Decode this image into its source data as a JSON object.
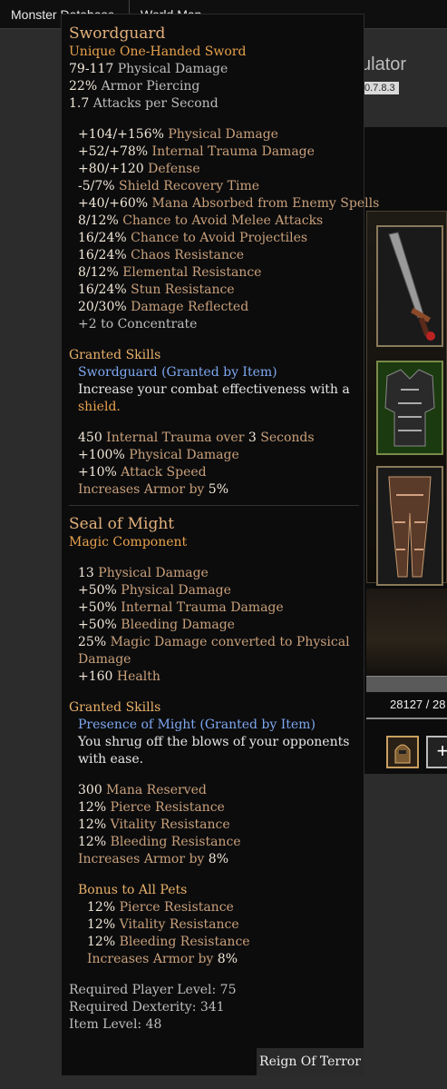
{
  "nav": {
    "tab1": "Monster Database",
    "tab2": "World Map"
  },
  "bg": {
    "title_fragment": "ulator",
    "version": "0.7.8.3",
    "xp": "28127 / 28"
  },
  "item": {
    "name": "Swordguard",
    "type": "Unique One-Handed Sword",
    "base": [
      {
        "v": "79-117",
        "t": " Physical Damage"
      },
      {
        "v": "22%",
        "t": " Armor Piercing"
      },
      {
        "v": "1.7",
        "t": " Attacks per Second"
      }
    ],
    "mods": [
      {
        "v": "+104/+156%",
        "t": " Physical Damage"
      },
      {
        "v": "+52/+78%",
        "t": " Internal Trauma Damage"
      },
      {
        "v": "+80/+120",
        "t": " Defense"
      },
      {
        "v": "-5/7%",
        "t": " Shield Recovery Time"
      },
      {
        "v": "+40/+60%",
        "t": " Mana Absorbed from Enemy Spells"
      },
      {
        "v": "8/12%",
        "t": " Chance to Avoid Melee Attacks"
      },
      {
        "v": "16/24%",
        "t": " Chance to Avoid Projectiles"
      },
      {
        "v": "16/24%",
        "t": " Chaos Resistance"
      },
      {
        "v": "8/12%",
        "t": " Elemental Resistance"
      },
      {
        "v": "16/24%",
        "t": " Stun Resistance"
      },
      {
        "v": "20/30%",
        "t": " Damage Reflected"
      },
      {
        "v": "+2 to Concentrate",
        "t": ""
      }
    ],
    "granted_head": "Granted Skills",
    "skill_name": "Swordguard (Granted by Item)",
    "skill_desc_a": "Increase your combat effectiveness with a",
    "skill_desc_b": "shield.",
    "skill_stats": [
      {
        "v": "450",
        "t": " Internal Trauma over ",
        "v2": "3",
        "t2": " Seconds"
      },
      {
        "v": "+100%",
        "t": " Physical Damage"
      },
      {
        "v": "+10%",
        "t": " Attack Speed"
      },
      {
        "v": "",
        "t": "Increases Armor by ",
        "v2": "5%",
        "t2": ""
      }
    ]
  },
  "component": {
    "name": "Seal of Might",
    "type": "Magic Component",
    "mods": [
      {
        "v": "13",
        "t": " Physical Damage"
      },
      {
        "v": "+50%",
        "t": " Physical Damage"
      },
      {
        "v": "+50%",
        "t": " Internal Trauma Damage"
      },
      {
        "v": "+50%",
        "t": " Bleeding Damage"
      }
    ],
    "convert_v": "25%",
    "convert_t1": " Magic Damage converted to Physical",
    "convert_t2": "Damage",
    "health_v": "+160",
    "health_t": " Health",
    "granted_head": "Granted Skills",
    "skill_name": "Presence of Might (Granted by Item)",
    "skill_desc_a": "You shrug off the blows of your opponents",
    "skill_desc_b": "with ease.",
    "skill_stats": [
      {
        "v": "300",
        "t": " Mana Reserved"
      },
      {
        "v": "12%",
        "t": " Pierce Resistance"
      },
      {
        "v": "12%",
        "t": " Vitality Resistance"
      },
      {
        "v": "12%",
        "t": " Bleeding Resistance"
      },
      {
        "v": "",
        "t": "Increases Armor by ",
        "v2": "8%"
      }
    ],
    "pets_head": "Bonus to All Pets",
    "pet_stats": [
      {
        "v": "12%",
        "t": " Pierce Resistance"
      },
      {
        "v": "12%",
        "t": " Vitality Resistance"
      },
      {
        "v": "12%",
        "t": " Bleeding Resistance"
      },
      {
        "v": "",
        "t": "Increases Armor by ",
        "v2": "8%"
      }
    ]
  },
  "requirements": {
    "level": "Required Player Level: 75",
    "dex": "Required Dexterity: 341",
    "item_level": "Item Level: 48"
  },
  "expansion": "Reign Of Terror"
}
